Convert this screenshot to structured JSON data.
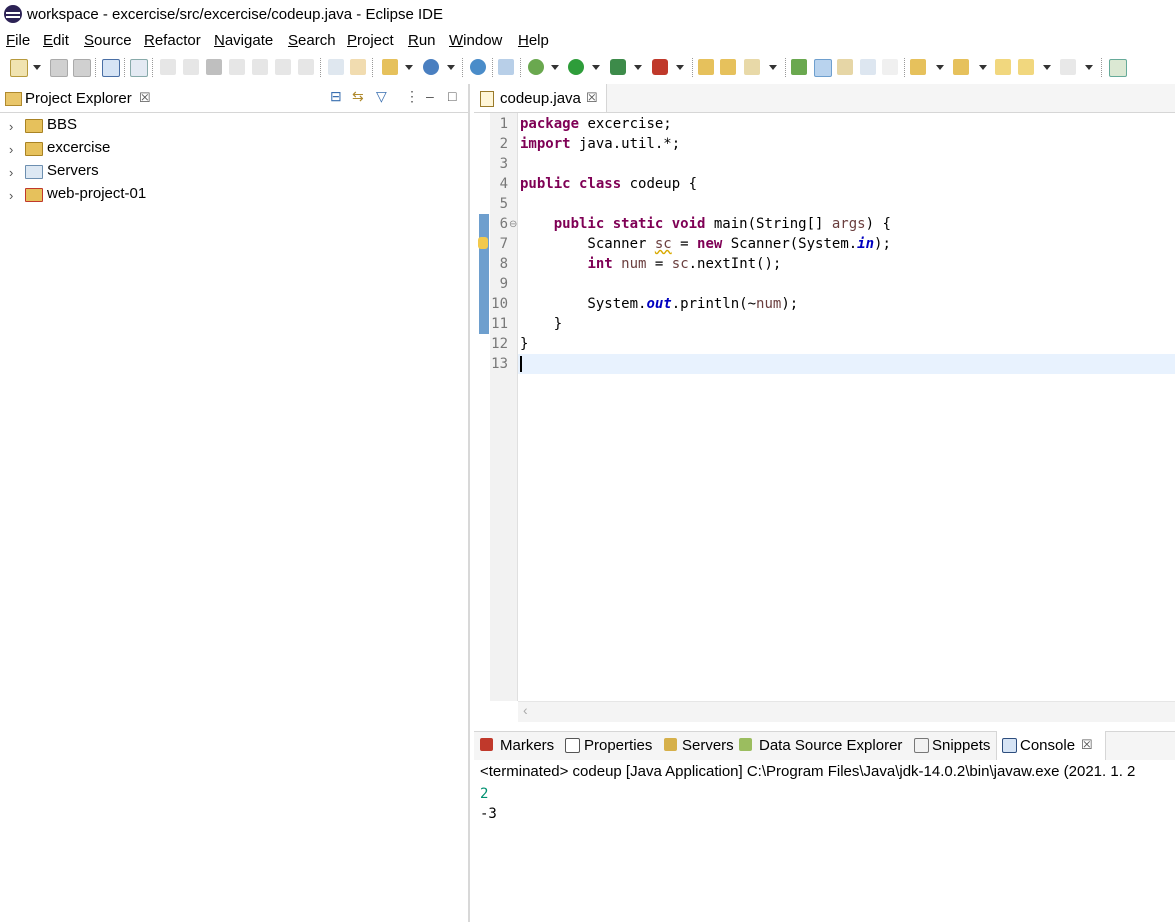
{
  "window": {
    "title": "workspace - excercise/src/excercise/codeup.java - Eclipse IDE"
  },
  "menu": [
    "File",
    "Edit",
    "Source",
    "Refactor",
    "Navigate",
    "Search",
    "Project",
    "Run",
    "Window",
    "Help"
  ],
  "project_explorer": {
    "title": "Project Explorer",
    "close_glyph": "☒",
    "items": [
      {
        "label": "BBS",
        "chevron": "›"
      },
      {
        "label": "excercise",
        "chevron": "›"
      },
      {
        "label": "Servers",
        "chevron": "›"
      },
      {
        "label": "web-project-01",
        "chevron": "›"
      }
    ]
  },
  "editor": {
    "tab_label": "codeup.java",
    "close_glyph": "☒",
    "line_numbers": [
      "1",
      "2",
      "3",
      "4",
      "5",
      "6",
      "7",
      "8",
      "9",
      "10",
      "11",
      "12",
      "13"
    ],
    "code": {
      "l1_kw": "package",
      "l1_rest": " excercise;",
      "l2_kw": "import",
      "l2_rest": " java.util.*;",
      "l4_kw": "public class",
      "l4_rest": " codeup {",
      "l6_indent": "    ",
      "l6_kw": "public static void",
      "l6_mid": " main(String[] ",
      "l6_par": "args",
      "l6_end": ") {",
      "l7_pre": "        Scanner ",
      "l7_var": "sc",
      "l7_mid": " = ",
      "l7_kw": "new",
      "l7_mid2": " Scanner(System.",
      "l7_fld": "in",
      "l7_end": ");",
      "l8_pre": "        ",
      "l8_kw": "int",
      "l8_mid": " ",
      "l8_var": "num",
      "l8_mid2": " = ",
      "l8_var2": "sc",
      "l8_end": ".nextInt();",
      "l10_pre": "        System.",
      "l10_fld": "out",
      "l10_mid": ".println(~",
      "l10_var": "num",
      "l10_end": ");",
      "l11": "    }",
      "l12": "}"
    },
    "scroll_arrow": "‹"
  },
  "bottom_panel": {
    "tabs": [
      "Markers",
      "Properties",
      "Servers",
      "Data Source Explorer",
      "Snippets",
      "Console"
    ],
    "console_close_glyph": "☒",
    "status": "<terminated> codeup [Java Application] C:\\Program Files\\Java\\jdk-14.0.2\\bin\\javaw.exe  (2021. 1. 2",
    "output": [
      "2",
      "-3"
    ]
  },
  "colors": {
    "keyword": "#7f0055",
    "field": "#0000c0",
    "input_text": "#009070",
    "ruler": "#6e9fce",
    "current_line": "#e8f2fe"
  }
}
